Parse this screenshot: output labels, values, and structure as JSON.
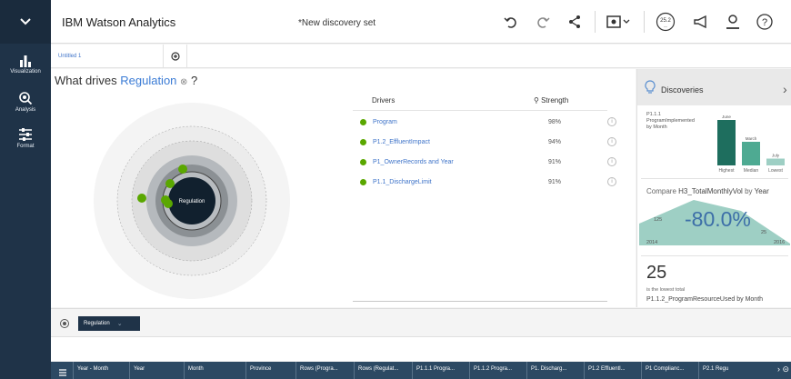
{
  "app": {
    "title": "IBM Watson Analytics",
    "set_title": "*New discovery set"
  },
  "toolbar": {
    "undo_icon": "undo-icon",
    "redo_icon": "redo-icon",
    "share_icon": "share-icon",
    "view_icon": "view-mode-icon",
    "badge_value": "25.2",
    "badge_sub": "—",
    "announce_icon": "announce-icon",
    "user_icon": "user-icon",
    "help_icon": "help-icon"
  },
  "rail": {
    "items": [
      {
        "label": "Visualization",
        "icon": "bar-chart-icon"
      },
      {
        "label": "Analysis",
        "icon": "analysis-icon"
      },
      {
        "label": "Format",
        "icon": "sliders-icon"
      }
    ]
  },
  "tabs": {
    "active": "Untitled 1"
  },
  "question": {
    "prefix": "What drives ",
    "target": "Regulation",
    "suffix": " ?"
  },
  "spiral": {
    "center_label": "Regulation"
  },
  "drivers": {
    "header_drivers": "Drivers",
    "header_strength": "Strength",
    "rows": [
      {
        "name": "Program",
        "strength": "98%"
      },
      {
        "name": "P1.2_EffluentImpact",
        "strength": "94%"
      },
      {
        "name": "P1_OwnerRecords and Year",
        "strength": "91%"
      },
      {
        "name": "P1.1_DischargeLimit",
        "strength": "91%"
      }
    ]
  },
  "discoveries": {
    "title": "Discoveries",
    "card1": {
      "label": "P1.1.1\nProgramImplemented\nby Month",
      "bars": [
        {
          "month": "June",
          "rank": "Highest",
          "value": 100
        },
        {
          "month": "March",
          "rank": "Median",
          "value": 52
        },
        {
          "month": "July",
          "rank": "Lowest",
          "value": 15
        }
      ]
    },
    "card2": {
      "title_prefix": "Compare ",
      "measure": "H3_TotalMonthlyVol",
      "title_mid": " by ",
      "dim": "Year",
      "percent": "-80.0%",
      "start_value": "125",
      "end_value": "25",
      "start_year": "2014",
      "end_year": "2016"
    },
    "card3": {
      "value": "25",
      "sub": "is the lowest total",
      "desc_measure": "P1.1.2_ProgramResourceUsed",
      "desc_by": " by ",
      "desc_dim": "Month"
    }
  },
  "target_bar": {
    "chip_label": "Regulation"
  },
  "dataset_columns": [
    "Year - Month",
    "Year",
    "Month",
    "Province",
    "Rows (Progra...",
    "Rows (Regulat...",
    "P1.1.1 Progra...",
    "P1.1.2 Progra...",
    "P1. Discharg...",
    "P1.2 Effluentl...",
    "P1 Complianc...",
    "P2.1 Regu"
  ]
}
